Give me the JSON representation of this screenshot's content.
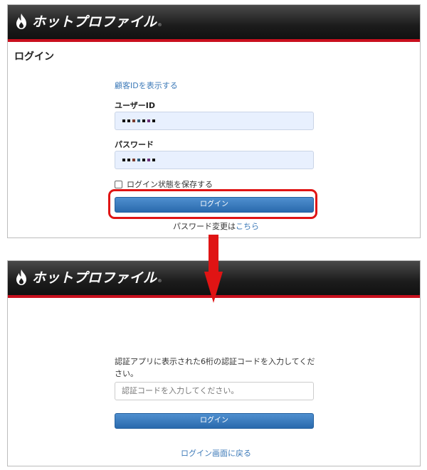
{
  "brand": {
    "name": "ホットプロファイル",
    "reg_mark": "®",
    "accent": "#c8101e",
    "icon": "flame-icon"
  },
  "login_panel": {
    "title": "ログイン",
    "show_customer_id_link": "顧客IDを表示する",
    "user_id_label": "ユーザーID",
    "password_label": "パスワード",
    "remember_label": "ログイン状態を保存する",
    "remember_checked": false,
    "login_button": "ログイン",
    "password_change_prefix": "パスワード変更は",
    "password_change_link": "こちら"
  },
  "flow_arrow": {
    "icon": "arrow-down-icon",
    "color": "#e01414"
  },
  "verify_panel": {
    "instruction": "認証アプリに表示された6桁の認証コードを入力してください。",
    "code_placeholder": "認証コードを入力してください。",
    "login_button": "ログイン",
    "back_link": "ログイン画面に戻る"
  },
  "colors": {
    "link": "#3d7ab8",
    "button": "#2a6aad",
    "autofill": "#e8f0fe"
  }
}
